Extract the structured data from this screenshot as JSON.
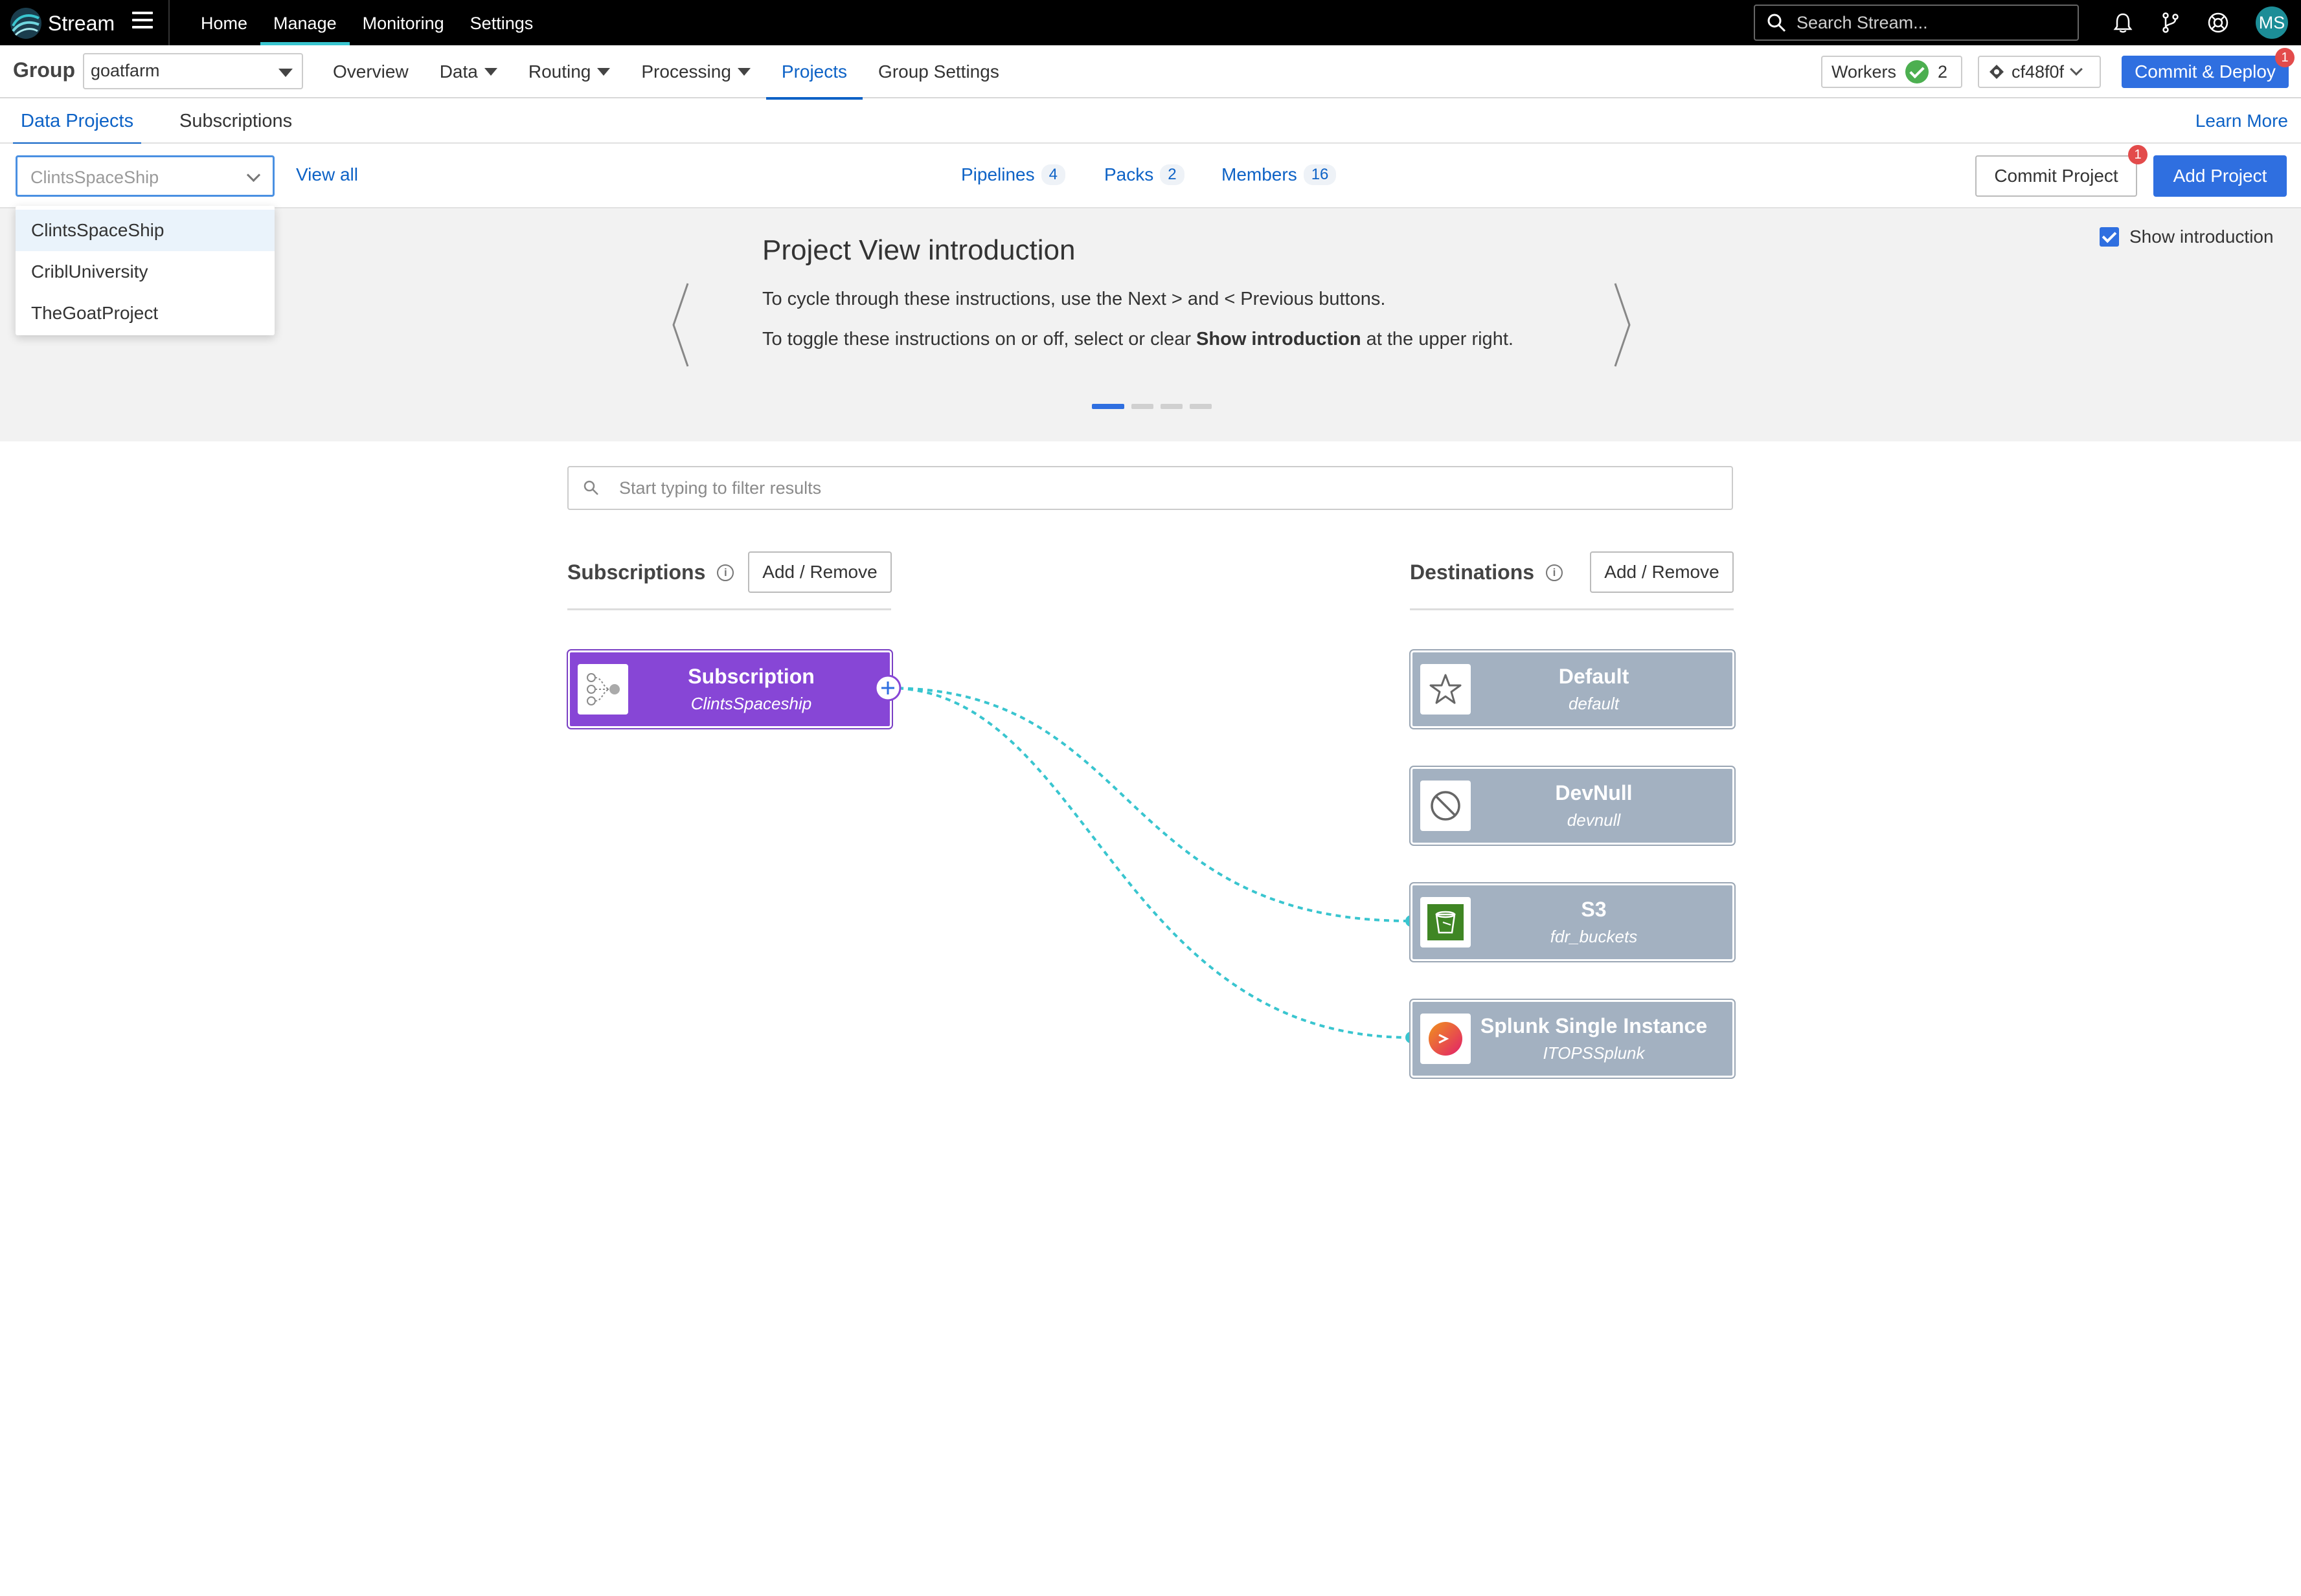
{
  "app": {
    "name": "Stream"
  },
  "topnav": {
    "items": [
      "Home",
      "Manage",
      "Monitoring",
      "Settings"
    ],
    "active": "Manage"
  },
  "search": {
    "placeholder": "Search Stream..."
  },
  "user": {
    "initials": "MS"
  },
  "groupbar": {
    "label": "Group",
    "group_value": "goatfarm",
    "nav": [
      {
        "label": "Overview",
        "dropdown": false
      },
      {
        "label": "Data",
        "dropdown": true
      },
      {
        "label": "Routing",
        "dropdown": true
      },
      {
        "label": "Processing",
        "dropdown": true
      },
      {
        "label": "Projects",
        "dropdown": false,
        "active": true
      },
      {
        "label": "Group Settings",
        "dropdown": false
      }
    ],
    "workers_label": "Workers",
    "workers_count": "2",
    "commit_hash": "cf48f0f",
    "deploy_label": "Commit & Deploy",
    "deploy_badge": "1"
  },
  "tabs": {
    "items": [
      "Data Projects",
      "Subscriptions"
    ],
    "active": "Data Projects",
    "learn_more": "Learn More"
  },
  "project_bar": {
    "selected_project": "ClintsSpaceShip",
    "view_all": "View all",
    "stats": [
      {
        "label": "Pipelines",
        "count": "4"
      },
      {
        "label": "Packs",
        "count": "2"
      },
      {
        "label": "Members",
        "count": "16"
      }
    ],
    "commit_project": "Commit Project",
    "commit_badge": "1",
    "add_project": "Add Project"
  },
  "dropdown": {
    "options": [
      "ClintsSpaceShip",
      "CriblUniversity",
      "TheGoatProject"
    ],
    "selected": "ClintsSpaceShip"
  },
  "intro": {
    "title": "Project View introduction",
    "line1": "To cycle through these instructions, use the Next > and < Previous buttons.",
    "line2_pre": "To toggle these instructions on or off, select or clear ",
    "line2_bold": "Show introduction",
    "line2_post": " at the upper right.",
    "show_intro_label": "Show introduction",
    "show_intro_checked": true,
    "slide_count": 4,
    "active_slide": 1
  },
  "filter": {
    "placeholder": "Start typing to filter results"
  },
  "subscriptions": {
    "heading": "Subscriptions",
    "add_remove": "Add / Remove",
    "items": [
      {
        "title": "Subscription",
        "subtitle": "ClintsSpaceship"
      }
    ]
  },
  "destinations": {
    "heading": "Destinations",
    "add_remove": "Add / Remove",
    "items": [
      {
        "title": "Default",
        "subtitle": "default",
        "icon": "star-icon",
        "connected": false
      },
      {
        "title": "DevNull",
        "subtitle": "devnull",
        "icon": "blocked-icon",
        "connected": false
      },
      {
        "title": "S3",
        "subtitle": "fdr_buckets",
        "icon": "s3-bucket-icon",
        "connected": true
      },
      {
        "title": "Splunk Single Instance",
        "subtitle": "ITOPSSplunk",
        "icon": "splunk-icon",
        "connected": true
      }
    ]
  },
  "colors": {
    "accent": "#2f6fe0",
    "subscription": "#8746d6",
    "destination": "#a3b1c1",
    "connection": "#39c5cf"
  }
}
